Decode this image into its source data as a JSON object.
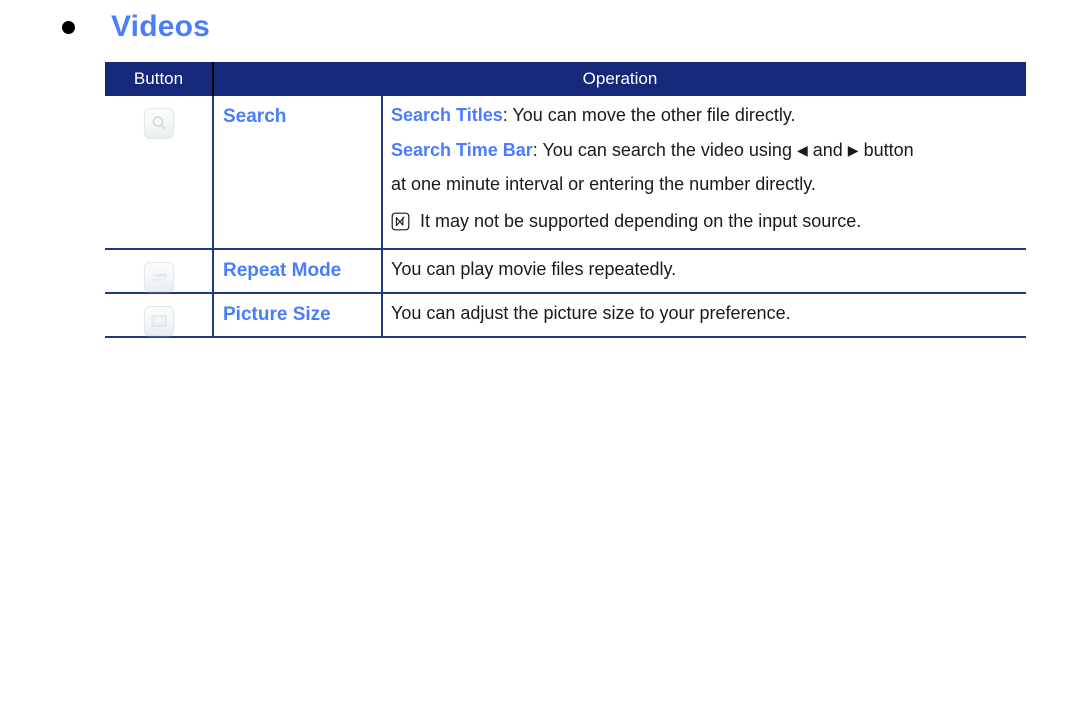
{
  "heading": {
    "bullet": "bullet-dot",
    "title": "Videos"
  },
  "table": {
    "headers": {
      "button": "Button",
      "operation": "Operation"
    },
    "rows": [
      {
        "icon": "search-icon",
        "label": "Search",
        "lines": [
          {
            "keyword": "Search Titles",
            "separator": ": ",
            "text": "You can move the other file directly."
          },
          {
            "keyword": "Search Time Bar",
            "separator": ": ",
            "text_before": "You can search the video using ",
            "arrow_left": "◀",
            "text_mid": " and ",
            "arrow_right": "▶",
            "text_after": " button"
          },
          {
            "text": "at one minute interval or entering the number directly."
          }
        ],
        "note": {
          "icon": "note-icon",
          "text": "It may not be supported depending on the input source."
        }
      },
      {
        "icon": "repeat-mode-icon",
        "label": "Repeat Mode",
        "lines": [
          {
            "text": "You can play movie files repeatedly."
          }
        ]
      },
      {
        "icon": "picture-size-icon",
        "label": "Picture Size",
        "lines": [
          {
            "text": "You can adjust the picture size to your preference."
          }
        ]
      }
    ]
  },
  "colors": {
    "header_bg": "#15287a",
    "accent_blue": "#4a7dfc",
    "border_blue": "#1d3a84",
    "text": "#1a1a1a",
    "page_bg": "#ffffff"
  }
}
